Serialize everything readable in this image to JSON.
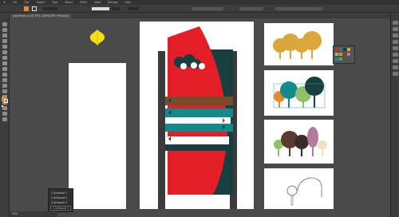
{
  "menu": {
    "items": [
      "Ai",
      "File",
      "Edit",
      "Object",
      "Type",
      "Select",
      "Effect",
      "View",
      "Window",
      "Help"
    ]
  },
  "document_tab": {
    "label": "pathfinder.ai @ 33% (CMYK/GPU Preview)"
  },
  "artboard_popup": {
    "items": [
      "1 Artboard 1",
      "2 Artboard 2",
      "3 Artboard 3",
      "4 Artboard 4"
    ],
    "selected": "4 Artboard 4"
  },
  "statusbar": {
    "zoom": "33%"
  },
  "colors": {
    "app_background": "#4a4a4a",
    "red": "#e41e26",
    "teal": "#138a8a",
    "dark_teal": "#173f3f",
    "brown": "#7b4a2a",
    "mustard": "#d9a73a",
    "yellow_leaf": "#f5df1a",
    "orange": "#e58a2c",
    "green": "#8fc16a",
    "plum": "#b07b9c",
    "cream": "#eee2c4"
  },
  "icons": [
    "leaf-icon",
    "tool-icons",
    "panel-icons"
  ]
}
